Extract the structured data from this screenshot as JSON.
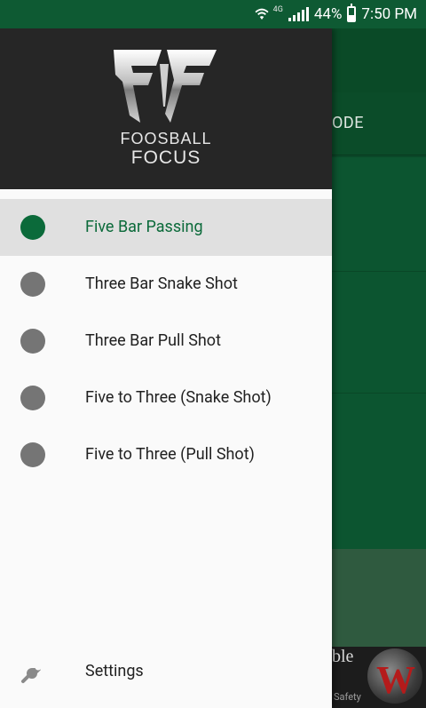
{
  "status_bar": {
    "network": "4G",
    "battery": "44%",
    "time": "7:50 PM"
  },
  "background": {
    "tab_text": "ODE",
    "ad_text": "ble",
    "ad_small": "Safety"
  },
  "drawer": {
    "logo": {
      "line1": "FOOSBALL",
      "line2": "FOCUS"
    },
    "items": [
      {
        "label": "Five Bar Passing",
        "selected": true
      },
      {
        "label": "Three Bar Snake Shot",
        "selected": false
      },
      {
        "label": "Three Bar Pull Shot",
        "selected": false
      },
      {
        "label": "Five to Three (Snake Shot)",
        "selected": false
      },
      {
        "label": "Five to Three (Pull Shot)",
        "selected": false
      }
    ],
    "settings_label": "Settings"
  },
  "colors": {
    "accent": "#0b6a3a",
    "header_bg": "#262626",
    "dot_inactive": "#757575"
  },
  "icons": {
    "wifi": "wifi-icon",
    "signal": "signal-icon",
    "battery": "battery-icon",
    "settings": "wrench-icon"
  }
}
